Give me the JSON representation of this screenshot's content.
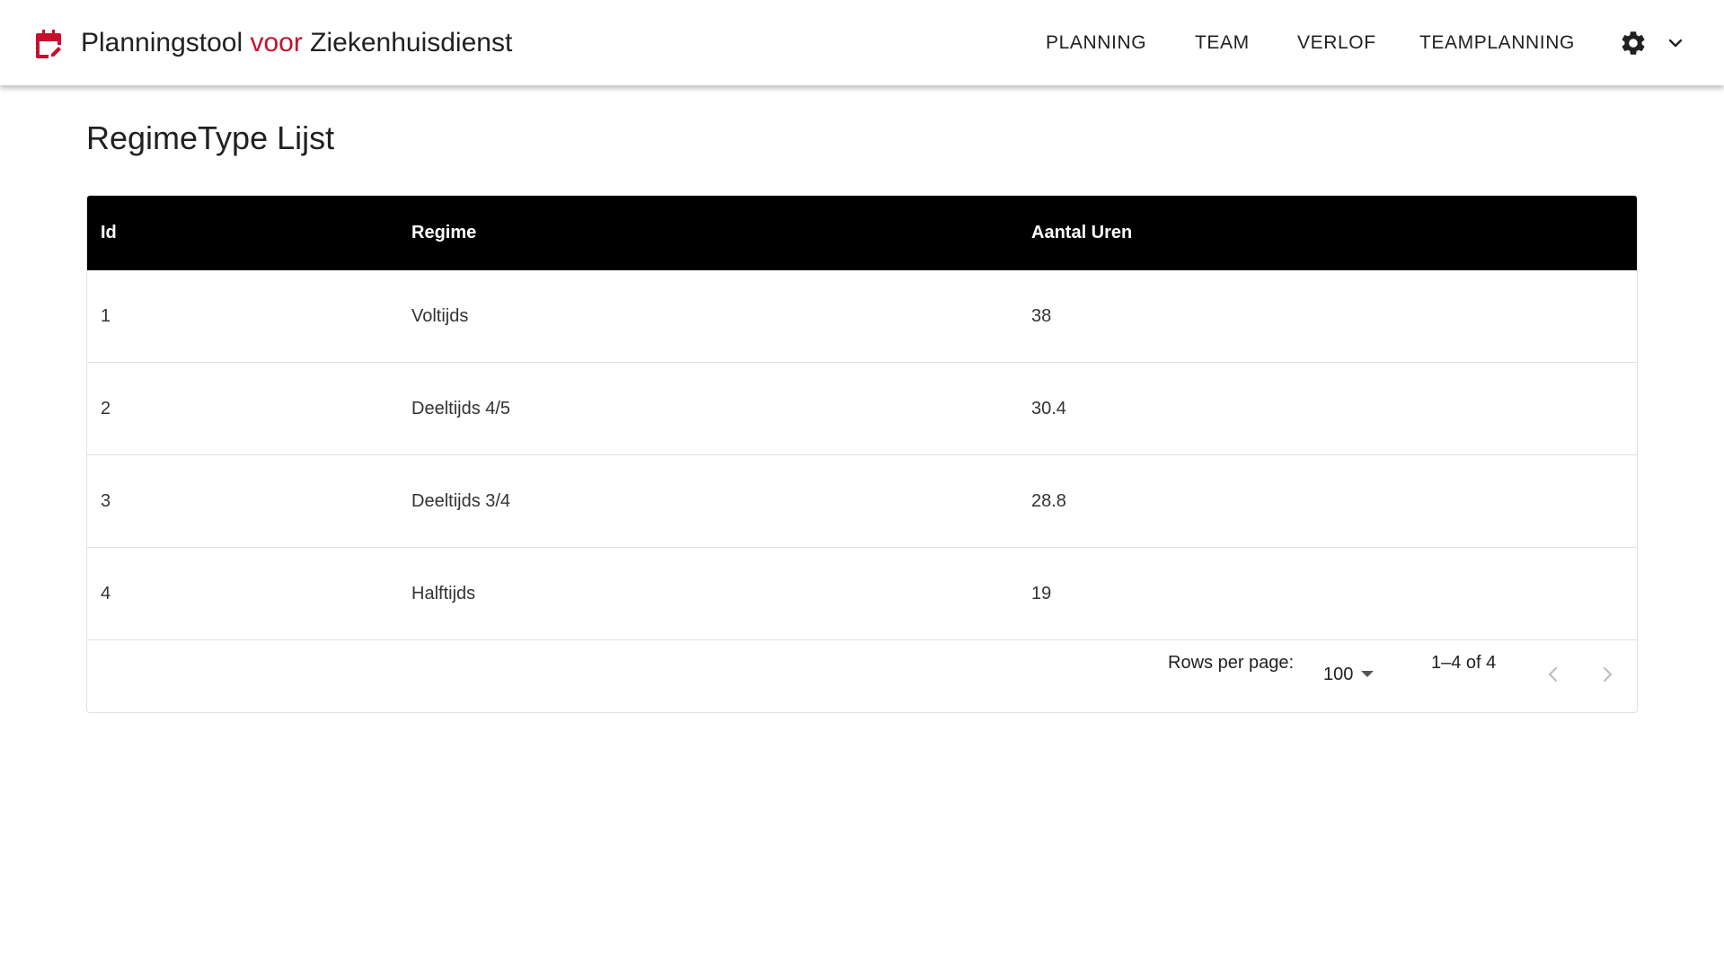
{
  "app": {
    "title_prefix": "Planningstool ",
    "title_accent": "voor",
    "title_suffix": " Ziekenhuisdienst",
    "brand_icon": "calendar-edit-icon",
    "accent_color": "#c8102e"
  },
  "nav": {
    "items": [
      {
        "label": "PLANNING"
      },
      {
        "label": "TEAM"
      },
      {
        "label": "VERLOF"
      },
      {
        "label": "TEAMPLANNING"
      }
    ],
    "settings_icon": "gear-icon",
    "menu_icon": "chevron-down-icon"
  },
  "page": {
    "title": "RegimeType Lijst"
  },
  "table": {
    "header_bg": "#000000",
    "columns": [
      "Id",
      "Regime",
      "Aantal Uren"
    ],
    "rows": [
      {
        "id": "1",
        "regime": "Voltijds",
        "uren": "38"
      },
      {
        "id": "2",
        "regime": "Deeltijds 4/5",
        "uren": "30.4"
      },
      {
        "id": "3",
        "regime": "Deeltijds 3/4",
        "uren": "28.8"
      },
      {
        "id": "4",
        "regime": "Halftijds",
        "uren": "19"
      }
    ]
  },
  "pagination": {
    "rows_per_page_label": "Rows per page:",
    "rows_per_page_value": "100",
    "range_text": "1–4 of 4",
    "prev_icon": "chevron-left-icon",
    "next_icon": "chevron-right-icon"
  }
}
